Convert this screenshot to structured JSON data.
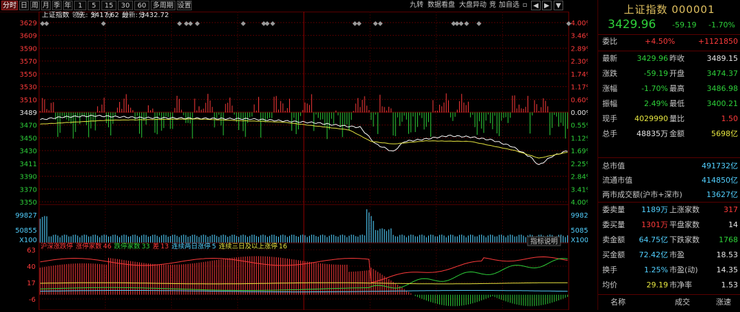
{
  "toolbar": {
    "tabs": [
      "分时",
      "日",
      "周",
      "月",
      "季",
      "年",
      "1分",
      "5分",
      "15分",
      "30分",
      "60分",
      "多周期",
      "设置"
    ],
    "active_tab": "分时",
    "right_buttons": [
      "九转",
      "数据看盘",
      "大盘异动",
      "竞",
      "加自选"
    ],
    "icons": [
      "lock-icon",
      "prev-arrow-icon",
      "next-arrow-icon",
      "dropdown-icon"
    ]
  },
  "header_info": {
    "index_name": "上证指数",
    "lead_label": "领先:",
    "lead_value": "3417.62",
    "latest_label": "最新:",
    "latest_value": "3432.72"
  },
  "price_axis_left": [
    "3629",
    "3609",
    "3590",
    "3570",
    "3550",
    "3530",
    "3510",
    "3489",
    "3470",
    "3450",
    "3430",
    "3411",
    "3390",
    "3370",
    "3350"
  ],
  "price_axis_right": [
    "4.00%",
    "3.46%",
    "2.89%",
    "2.30%",
    "1.74%",
    "1.17%",
    "0.60%",
    "0.00%",
    "0.55%",
    "1.12%",
    "1.69%",
    "2.25%",
    "2.84%",
    "3.41%",
    "4.00%"
  ],
  "volume_axis_left": [
    "99827",
    "50855",
    "X100"
  ],
  "volume_axis_right": [
    "99827",
    "50855",
    "X100"
  ],
  "indicator_label": "指标说明",
  "breadth_header": {
    "title": "沪深涨跌停",
    "limit_up_label": "涨停家数",
    "limit_up_value": "46",
    "limit_down_label": "跌停家数",
    "limit_down_value": "33",
    "diff_label": "差",
    "diff_value": "13",
    "two_board_label": "连续两日涨停",
    "two_board_value": "5",
    "three_board_label": "连续三日及以上涨停",
    "three_board_value": "16"
  },
  "breadth_axis": [
    "63",
    "40",
    "17",
    "-6"
  ],
  "quote": {
    "title": "上证指数 000001",
    "price": "3429.96",
    "change": "-59.19",
    "change_pct": "-1.70%",
    "ratio_label": "委比",
    "ratio_value": "+4.50%",
    "ratio_diff": "+1121850",
    "rows": [
      {
        "l1": "最新",
        "v1": "3429.96",
        "c1": "green",
        "l2": "昨收",
        "v2": "3489.15",
        "c2": "white"
      },
      {
        "l1": "涨跌",
        "v1": "-59.19",
        "c1": "green",
        "l2": "开盘",
        "v2": "3474.37",
        "c2": "green"
      },
      {
        "l1": "涨幅",
        "v1": "-1.70%",
        "c1": "green",
        "l2": "最高",
        "v2": "3486.98",
        "c2": "green"
      },
      {
        "l1": "振幅",
        "v1": "2.49%",
        "c1": "green",
        "l2": "最低",
        "v2": "3400.21",
        "c2": "green"
      },
      {
        "l1": "现手",
        "v1": "4029990",
        "c1": "yellow",
        "l2": "量比",
        "v2": "1.50",
        "c2": "red"
      },
      {
        "l1": "总手",
        "v1": "48835万",
        "c1": "white",
        "l2": "金额",
        "v2": "5698亿",
        "c2": "yellow"
      }
    ],
    "mkt": [
      {
        "l": "总市值",
        "v": "491732亿"
      },
      {
        "l": "流通市值",
        "v": "414850亿"
      },
      {
        "l": "两市成交额(沪市+深市)",
        "v": "13627亿"
      }
    ],
    "rows2": [
      {
        "l1": "委卖量",
        "v1": "1189万",
        "c1": "cyan",
        "l2": "上涨家数",
        "v2": "317",
        "c2": "red"
      },
      {
        "l1": "委买量",
        "v1": "1301万",
        "c1": "red",
        "l2": "平盘家数",
        "v2": "14",
        "c2": "white"
      },
      {
        "l1": "卖金额",
        "v1": "64.75亿",
        "c1": "cyan",
        "l2": "下跌家数",
        "v2": "1768",
        "c2": "green"
      },
      {
        "l1": "买金额",
        "v1": "72.42亿",
        "c1": "cyan",
        "l2": "市盈",
        "v2": "18.53",
        "c2": "white"
      },
      {
        "l1": "换手",
        "v1": "1.25%",
        "c1": "cyan",
        "l2": "市盈(动)",
        "v2": "14.35",
        "c2": "white"
      },
      {
        "l1": "均价",
        "v1": "29.19",
        "c1": "yellow",
        "l2": "市净率",
        "v2": "1.53",
        "c2": "white"
      }
    ],
    "bottom_cols": [
      "名称",
      "成交",
      "涨速"
    ]
  },
  "colors": {
    "up": "#ff3b3b",
    "down": "#2ed13a",
    "avg": "#e6e640",
    "grid": "#5a0000",
    "bg": "#000000"
  }
}
